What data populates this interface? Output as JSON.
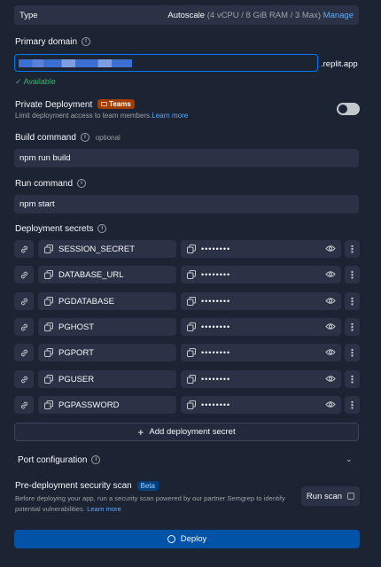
{
  "type_row": {
    "label": "Type",
    "value": "Autoscale",
    "spec": "(4 vCPU / 8 GiB RAM / 3 Max)",
    "manage_label": "Manage"
  },
  "domain": {
    "label": "Primary domain",
    "suffix": ".replit.app",
    "status": "Available"
  },
  "private": {
    "label": "Private Deployment",
    "badge": "Teams",
    "description": "Limit deployment access to team members.",
    "learn_more": "Learn more",
    "enabled": false
  },
  "build": {
    "label": "Build command",
    "optional": "optional",
    "value": "npm run build"
  },
  "run": {
    "label": "Run command",
    "value": "npm start"
  },
  "secrets": {
    "label": "Deployment secrets",
    "masked": "••••••••",
    "items": [
      {
        "name": "SESSION_SECRET"
      },
      {
        "name": "DATABASE_URL"
      },
      {
        "name": "PGDATABASE"
      },
      {
        "name": "PGHOST"
      },
      {
        "name": "PGPORT"
      },
      {
        "name": "PGUSER"
      },
      {
        "name": "PGPASSWORD"
      }
    ],
    "add_label": "Add deployment secret"
  },
  "port": {
    "label": "Port configuration"
  },
  "scan": {
    "title": "Pre-deployment security scan",
    "badge": "Beta",
    "description": "Before deploying your app, run a security scan powered by our partner Semgrep to identify potential vulnerabilities.",
    "learn_more": "Learn more",
    "button": "Run scan"
  },
  "deploy": {
    "label": "Deploy"
  },
  "colors": {
    "background": "#1c2333",
    "panel": "#2b3245",
    "accent_blue": "#0053a6",
    "link": "#57abff",
    "success": "#3eb36b",
    "teams_badge": "#a13d00"
  }
}
